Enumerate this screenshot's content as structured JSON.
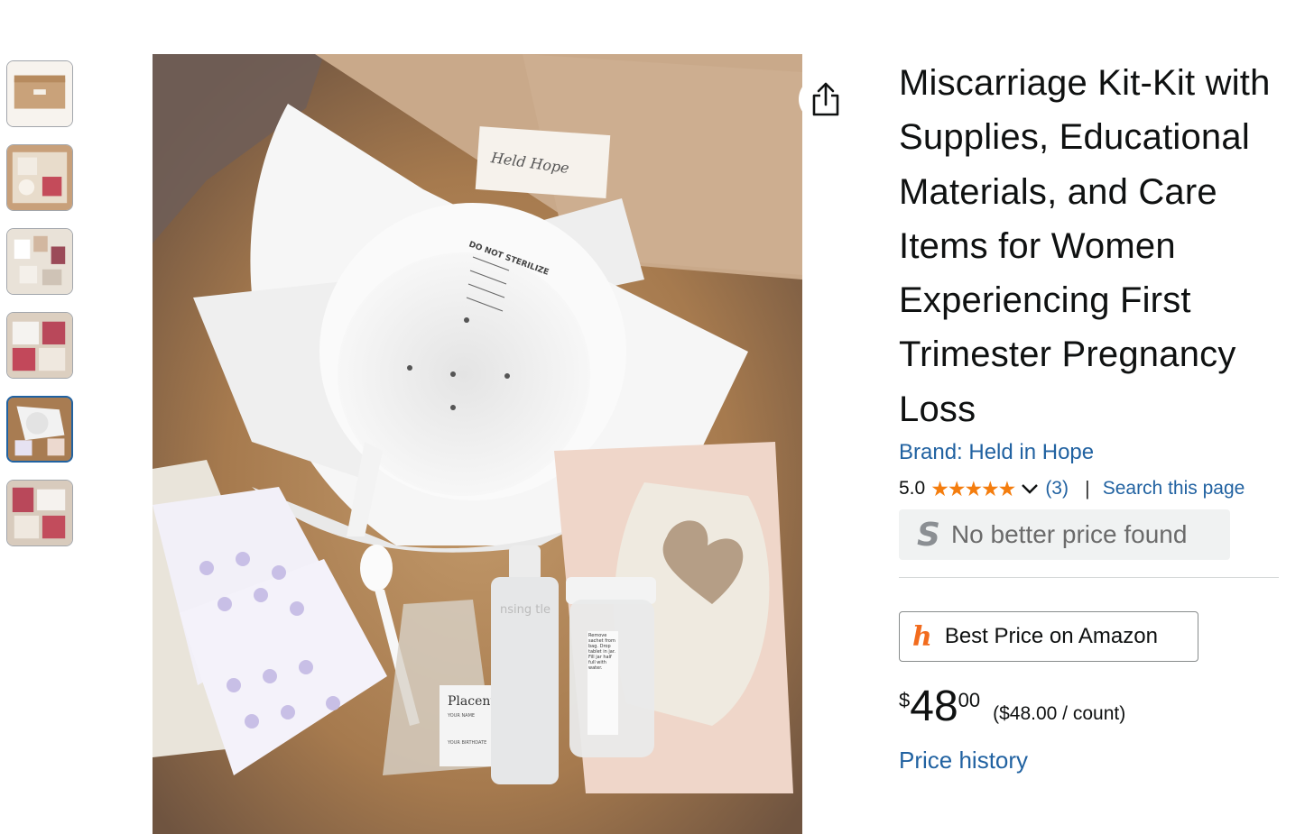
{
  "thumbnails": [
    {
      "label": "thumbnail-1",
      "selected": false
    },
    {
      "label": "thumbnail-2",
      "selected": false
    },
    {
      "label": "thumbnail-3",
      "selected": false
    },
    {
      "label": "thumbnail-4",
      "selected": false
    },
    {
      "label": "thumbnail-5",
      "selected": true
    },
    {
      "label": "thumbnail-6",
      "selected": false
    }
  ],
  "main_image": {
    "card_text": "Held Hope",
    "bowl_text": "DO NOT STERILIZE",
    "bag_label": "Placenta",
    "bag_small_1": "YOUR NAME",
    "bag_small_2": "YOUR BIRTHDATE",
    "bottle_text": "nsing tle",
    "jar_text": "Remove sachet from bag. Drop tablet in jar. Fill jar half full with water."
  },
  "share_icon": "share-icon",
  "product": {
    "title": "Miscarriage Kit-Kit with Supplies, Educational Materials, and Care Items for Women Experiencing First Trimester Pregnancy Loss",
    "brand": "Brand: Held in Hope",
    "rating": "5.0",
    "stars": "★★★★★",
    "rating_count": "(3)",
    "separator": "|",
    "search_page": "Search this page",
    "no_better_price": "No better price found",
    "no_better_price_icon": "S",
    "best_price_label": "Best Price on Amazon",
    "best_price_icon": "h",
    "price_symbol": "$",
    "price_whole": "48",
    "price_fraction": "00",
    "unit_price": "($48.00 / count)",
    "price_history": "Price history"
  },
  "colors": {
    "link": "#2162a1",
    "star": "#f47d0e",
    "honey": "#f26b1d"
  }
}
